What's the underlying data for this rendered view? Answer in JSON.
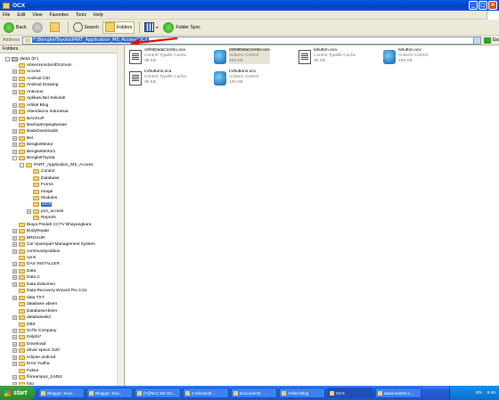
{
  "window": {
    "title": "OCX",
    "icon": "folder-icon"
  },
  "menu": [
    "File",
    "Edit",
    "View",
    "Favorites",
    "Tools",
    "Help"
  ],
  "toolbar": {
    "back_label": "Back",
    "search_label": "Search",
    "folders_label": "Folders",
    "folder_sync_label": "Folder Sync"
  },
  "address": {
    "label": "Address",
    "path": "F:\\BengkelToyota\\PART_Application_MS_Access\\OCX",
    "go_label": "Go"
  },
  "folders_pane": {
    "title": "Folders",
    "close": "×",
    "tree": [
      {
        "label": "data1 (D:)",
        "kind": "drive",
        "exp": "-"
      },
      {
        "label": "AbsenHondaAlDiUmum",
        "exp": ""
      },
      {
        "label": "Access",
        "exp": "+"
      },
      {
        "label": "Android CBI",
        "exp": "+"
      },
      {
        "label": "Android Drawing",
        "exp": "+"
      },
      {
        "label": "Antivirus",
        "exp": "+"
      },
      {
        "label": "Aplikasi Bel Sekolah",
        "exp": ""
      },
      {
        "label": "Artikel Blog",
        "exp": "+"
      },
      {
        "label": "Attendance Indonesia",
        "exp": "+"
      },
      {
        "label": "BACKUP",
        "exp": "+"
      },
      {
        "label": "BackupKepegawaian",
        "exp": ""
      },
      {
        "label": "BaduDownloads",
        "exp": "+"
      },
      {
        "label": "Bel",
        "exp": "+"
      },
      {
        "label": "BengkelMotor",
        "exp": "+"
      },
      {
        "label": "BengkelMotor1",
        "exp": "+"
      },
      {
        "label": "BengkelToyota",
        "exp": "-"
      },
      {
        "label": "PART_Application_MS_Access",
        "exp": "-"
      },
      {
        "label": "Control",
        "exp": ""
      },
      {
        "label": "Database",
        "exp": ""
      },
      {
        "label": "Forms",
        "exp": ""
      },
      {
        "label": "Image",
        "exp": ""
      },
      {
        "label": "Modules",
        "exp": ""
      },
      {
        "label": "OCX",
        "exp": "",
        "selected": true
      },
      {
        "label": "pos_access",
        "exp": "+"
      },
      {
        "label": "Reports",
        "exp": ""
      },
      {
        "label": "Biaya Pindah CCTV Bhayangkara",
        "exp": ""
      },
      {
        "label": "BodyRepair",
        "exp": "+"
      },
      {
        "label": "BROSUR",
        "exp": "+"
      },
      {
        "label": "Car Sparepart Management System",
        "exp": "+"
      },
      {
        "label": "communityedition",
        "exp": "+"
      },
      {
        "label": "cpns",
        "exp": ""
      },
      {
        "label": "DAS INSTALLER",
        "exp": "+"
      },
      {
        "label": "Data",
        "exp": "+"
      },
      {
        "label": "Data C",
        "exp": "+"
      },
      {
        "label": "Data Dokumen",
        "exp": "+"
      },
      {
        "label": "Data Recovery Wizard Pro 4.01",
        "exp": ""
      },
      {
        "label": "data TXT",
        "exp": "+"
      },
      {
        "label": "database absen",
        "exp": ""
      },
      {
        "label": "DatabaseAbsen",
        "exp": ""
      },
      {
        "label": "databaseskil",
        "exp": "+"
      },
      {
        "label": "DB3",
        "exp": ""
      },
      {
        "label": "Dcl'le Company",
        "exp": "+"
      },
      {
        "label": "Delphi7",
        "exp": "+"
      },
      {
        "label": "Download",
        "exp": "+"
      },
      {
        "label": "driver epson l120",
        "exp": "+"
      },
      {
        "label": "eclipse android",
        "exp": "+"
      },
      {
        "label": "Error Yudha",
        "exp": "+"
      },
      {
        "label": "Faktur",
        "exp": ""
      },
      {
        "label": "florean\\pos_14452",
        "exp": "+"
      },
      {
        "label": "foto",
        "exp": "+"
      }
    ]
  },
  "files": [
    {
      "name": "ctrlNtDataCombo.oca",
      "type": "Control Typelib Cache",
      "size": "36 KB",
      "icon": "typelib-cache-icon"
    },
    {
      "name": "ctrlNtDataCombo.ocx",
      "type": "ActiveX Control",
      "size": "268 KB",
      "icon": "activex-icon",
      "highlight": true
    },
    {
      "name": "lvbutton.oca",
      "type": "Control Typelib Cache",
      "size": "30 KB",
      "icon": "typelib-cache-icon"
    },
    {
      "name": "lvbutton.ocx",
      "type": "ActiveX Control",
      "size": "168 KB",
      "icon": "activex-icon"
    },
    {
      "name": "LVbuttons.oca",
      "type": "Control Typelib Cache",
      "size": "30 KB",
      "icon": "typelib-cache-icon"
    },
    {
      "name": "LVbuttons.ocx",
      "type": "ActiveX Control",
      "size": "140 KB",
      "icon": "activex-icon"
    }
  ],
  "taskbar": {
    "start_label": "start",
    "tasks": [
      {
        "label": "Blogger: Sour..."
      },
      {
        "label": "Blogger: Sou..."
      },
      {
        "label": "[T@M:C:SE:OC..."
      },
      {
        "label": "3 Microsoft ..."
      },
      {
        "label": "Document2 - ..."
      },
      {
        "label": "Artikel Blog"
      },
      {
        "label": "OCX",
        "active": true
      },
      {
        "label": "datamode03.1..."
      }
    ],
    "language": "EN",
    "clock": "9:40"
  },
  "colors": {
    "titlebar": "#0a58e0",
    "selection": "#316ac5",
    "annotation_arrow": "#e01010"
  }
}
